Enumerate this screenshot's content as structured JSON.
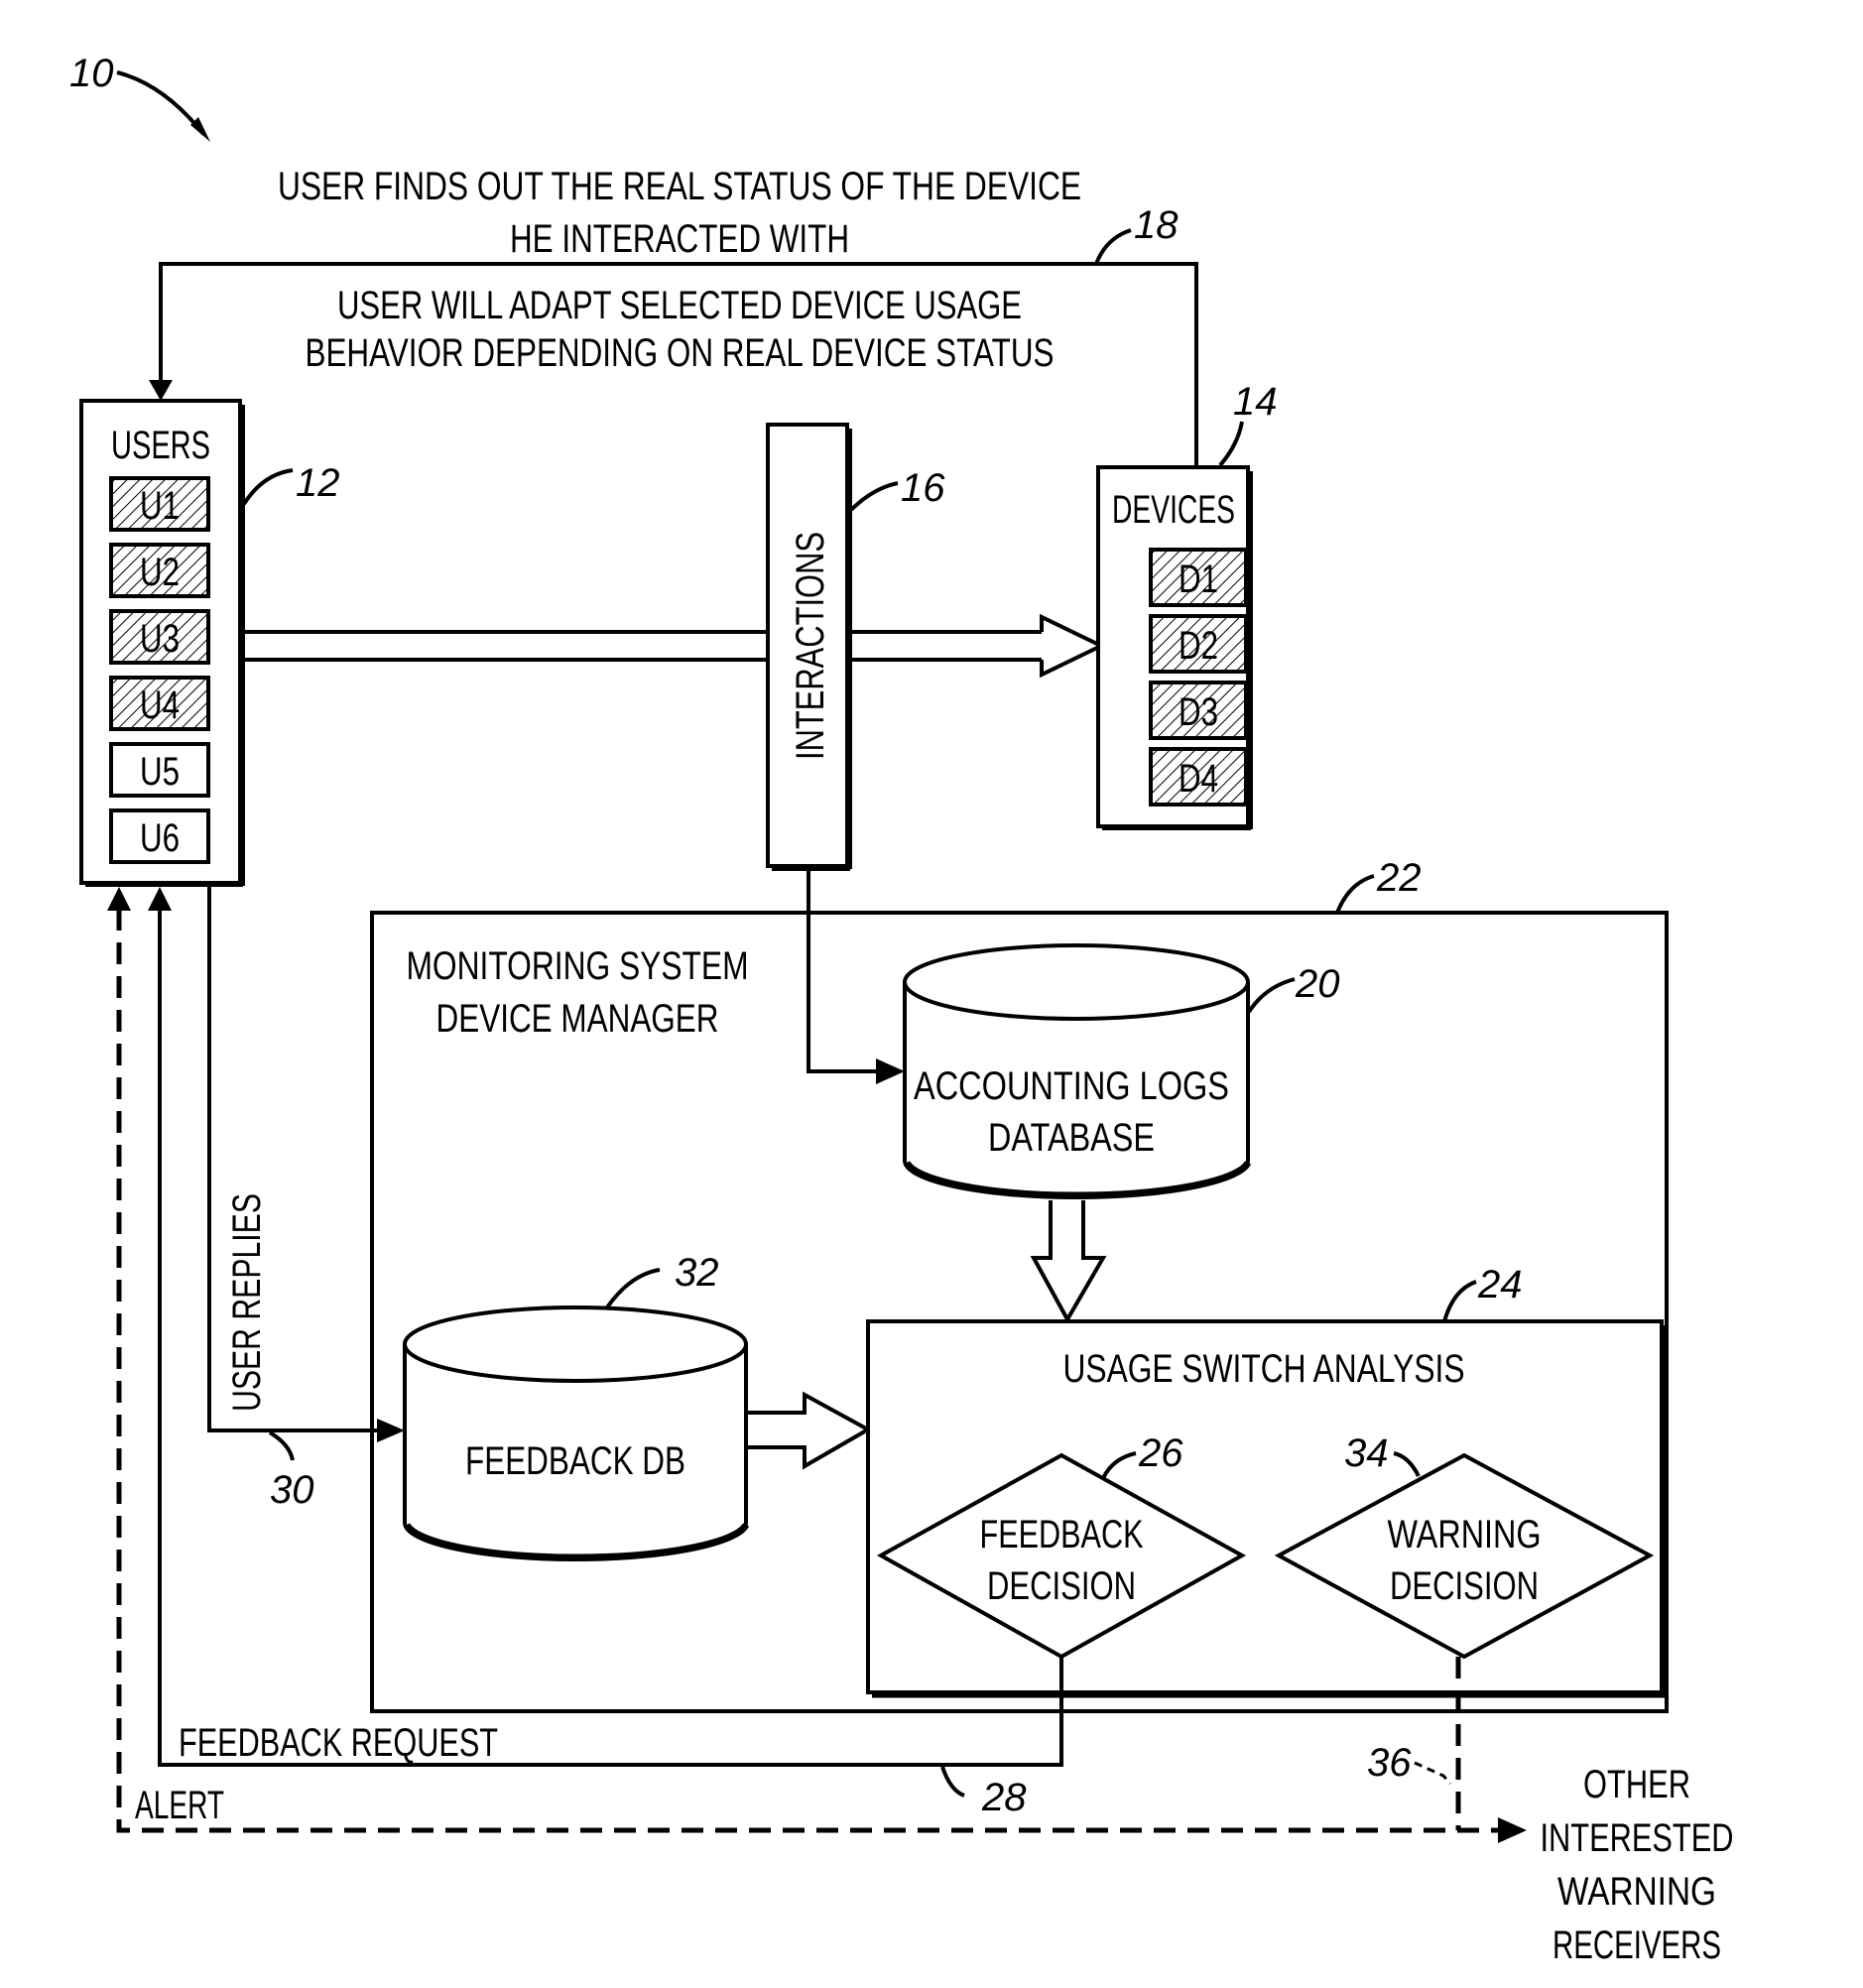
{
  "figure": {
    "reference": "10",
    "top_notes": {
      "line1": "USER FINDS OUT THE REAL STATUS OF THE DEVICE",
      "line2": "HE INTERACTED WITH",
      "line3": "USER WILL ADAPT SELECTED DEVICE USAGE",
      "line4": "BEHAVIOR DEPENDING ON REAL DEVICE STATUS",
      "reference": "18"
    },
    "users": {
      "title": "USERS",
      "reference": "12",
      "items": [
        {
          "label": "U1",
          "hatched": true
        },
        {
          "label": "U2",
          "hatched": true
        },
        {
          "label": "U3",
          "hatched": true
        },
        {
          "label": "U4",
          "hatched": true
        },
        {
          "label": "U5",
          "hatched": false
        },
        {
          "label": "U6",
          "hatched": false
        }
      ]
    },
    "interactions": {
      "label": "INTERACTIONS",
      "reference": "16"
    },
    "devices": {
      "title": "DEVICES",
      "reference": "14",
      "items": [
        {
          "label": "D1",
          "hatched": true
        },
        {
          "label": "D2",
          "hatched": true
        },
        {
          "label": "D3",
          "hatched": true
        },
        {
          "label": "D4",
          "hatched": true
        }
      ]
    },
    "monitoring_system": {
      "line1": "MONITORING SYSTEM",
      "line2": "DEVICE MANAGER",
      "reference": "22"
    },
    "accounting_db": {
      "line1": "ACCOUNTING LOGS",
      "line2": "DATABASE",
      "reference": "20"
    },
    "feedback_db": {
      "label": "FEEDBACK DB",
      "reference": "32"
    },
    "usage_switch_analysis": {
      "title": "USAGE SWITCH ANALYSIS",
      "reference": "24",
      "feedback_decision": {
        "line1": "FEEDBACK",
        "line2": "DECISION",
        "reference": "26"
      },
      "warning_decision": {
        "line1": "WARNING",
        "line2": "DECISION",
        "reference": "34"
      }
    },
    "user_replies": {
      "label": "USER REPLIES",
      "reference": "30"
    },
    "feedback_request": {
      "label": "FEEDBACK REQUEST",
      "reference": "28"
    },
    "alert": {
      "label": "ALERT",
      "reference": "36"
    },
    "other_receivers": {
      "line1": "OTHER",
      "line2": "INTERESTED",
      "line3": "WARNING",
      "line4": "RECEIVERS"
    }
  }
}
